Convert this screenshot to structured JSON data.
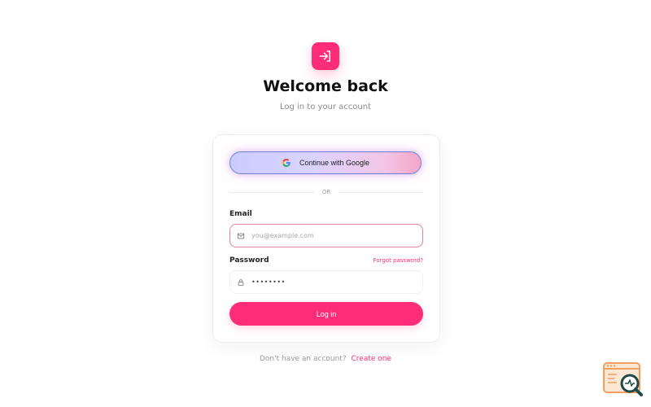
{
  "header": {
    "title": "Welcome back",
    "subtitle": "Log in to your account",
    "logo_icon": "login-arrow-icon"
  },
  "form": {
    "google_button_label": "Continue with Google",
    "divider_text": "OR",
    "email_label": "Email",
    "email_placeholder": "you@example.com",
    "email_value": "",
    "password_label": "Password",
    "forgot_password_label": "Forgot password?",
    "password_value": "••••••••",
    "login_button_label": "Log in"
  },
  "footer": {
    "prompt_text": "Don't have an account?",
    "create_link_label": "Create one"
  },
  "colors": {
    "accent": "#ff2d78",
    "text": "#111111",
    "muted": "#8a8a8a"
  },
  "icons": {
    "google": "google-icon",
    "email": "mail-icon",
    "password": "lock-icon",
    "corner": "search-report-icon"
  }
}
